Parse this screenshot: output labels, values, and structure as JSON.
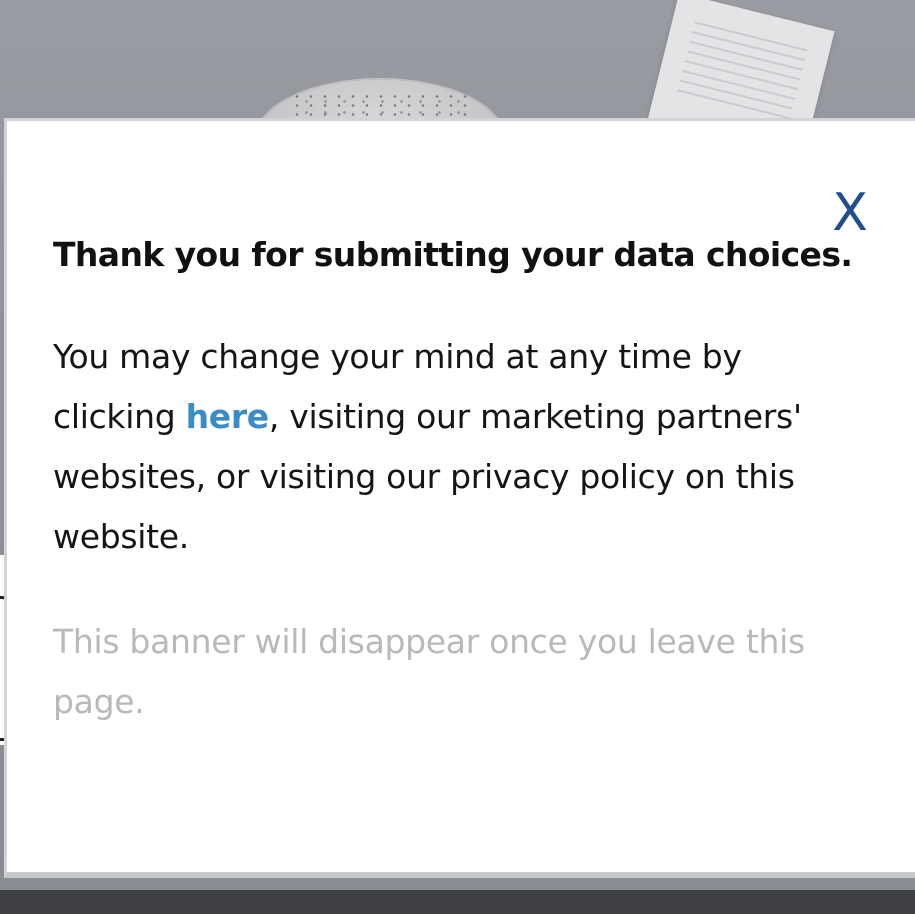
{
  "modal": {
    "close_label": "X",
    "title": "Thank you for submitting your data choices.",
    "body": {
      "before_link": "You may change your mind at any time by clicking ",
      "link_text": "here",
      "after_link": ", visiting our marketing partners' websites, or visiting our privacy policy on this website."
    },
    "note": "This banner will disappear once you leave this page."
  },
  "colors": {
    "link": "#3b8bc6",
    "close": "#1f4e8c",
    "note": "#b8b9bc"
  }
}
